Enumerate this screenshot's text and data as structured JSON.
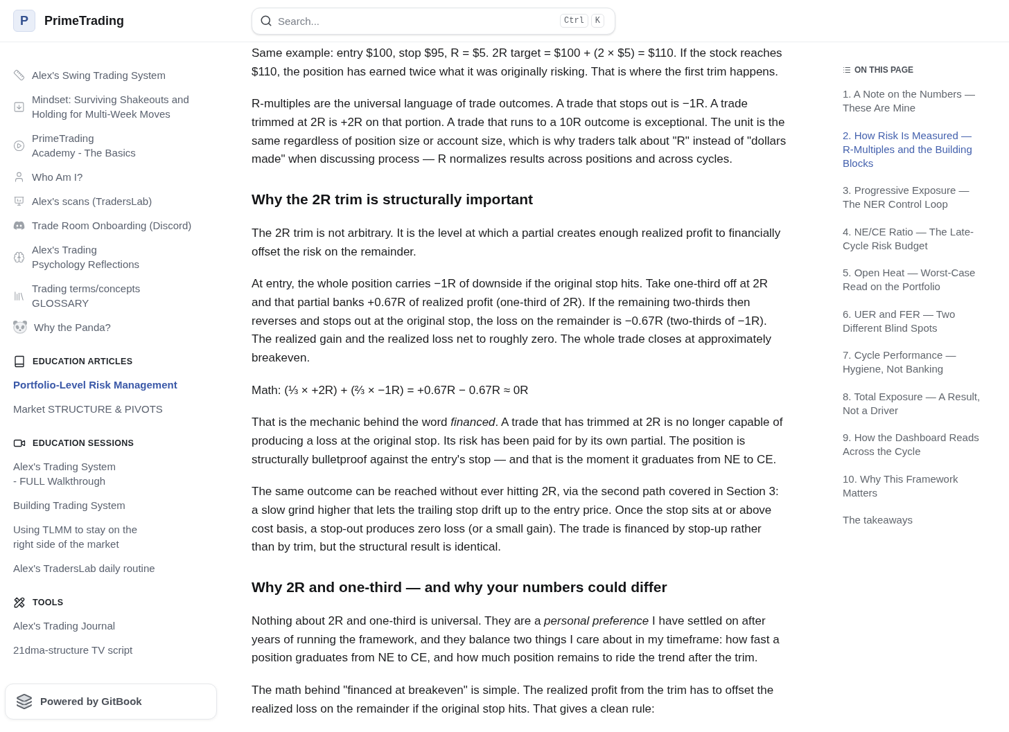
{
  "header": {
    "logo_letter": "P",
    "site_name": "PrimeTrading",
    "search": {
      "placeholder": "Search...",
      "shortcut": [
        "Ctrl",
        "K"
      ]
    }
  },
  "sidebar": {
    "items": [
      {
        "label": "Alex's Swing Trading System",
        "selected": false
      },
      {
        "label": "Mindset: Surviving Shakeouts and\nHolding for Multi-Week Moves",
        "selected": false
      },
      {
        "label": "PrimeTrading\nAcademy - The Basics",
        "selected": false
      },
      {
        "label": "Who Am I?",
        "selected": false
      },
      {
        "label": "Alex's scans (TradersLab)",
        "selected": false
      },
      {
        "label": "Trade Room Onboarding (Discord)",
        "selected": false
      },
      {
        "label": "Alex's Trading\nPsychology Reflections",
        "selected": false
      },
      {
        "label": "Trading terms/concepts\nGLOSSARY",
        "selected": false
      },
      {
        "label": "Why the Panda?",
        "selected": false
      }
    ],
    "sections": [
      {
        "title": "EDUCATION ARTICLES",
        "items": [
          {
            "label": "Portfolio-Level Risk Management",
            "selected": true
          },
          {
            "label": "Market STRUCTURE & PIVOTS",
            "selected": false
          }
        ]
      },
      {
        "title": "EDUCATION SESSIONS",
        "items": [
          {
            "label": "Alex's Trading System\n- FULL Walkthrough",
            "selected": false
          },
          {
            "label": "Building Trading System",
            "selected": false
          },
          {
            "label": "Using TLMM to stay on the\nright side of the market",
            "selected": false
          },
          {
            "label": "Alex's TradersLab daily routine",
            "selected": false
          }
        ]
      },
      {
        "title": "TOOLS",
        "items": [
          {
            "label": "Alex's Trading Journal",
            "selected": false
          },
          {
            "label": "21dma-structure TV script",
            "selected": false
          }
        ]
      }
    ],
    "footer": "Powered by GitBook"
  },
  "article": [
    {
      "kind": "paragraph",
      "text": "Same example: entry $100, stop $95, R = $5. 2R target = $100 + (2 × $5) = $110. If the stock reaches $110, the position has earned twice what it was originally risking. That is where the first trim happens."
    },
    {
      "kind": "paragraph",
      "text": "R-multiples are the universal language of trade outcomes. A trade that stops out is −1R. A trade trimmed at 2R is +2R on that portion. A trade that runs to a 10R outcome is exceptional. The unit is the same regardless of position size or account size, which is why traders talk about \"R\" instead of \"dollars made\" when discussing process — R normalizes results across positions and across cycles."
    },
    {
      "kind": "heading",
      "text": "Why the 2R trim is structurally important"
    },
    {
      "kind": "paragraph",
      "text": "The 2R trim is not arbitrary. It is the level at which a partial creates enough realized profit to financially offset the risk on the remainder."
    },
    {
      "kind": "paragraph",
      "text": "At entry, the whole position carries −1R of downside if the original stop hits. Take one-third off at 2R and that partial banks +0.67R of realized profit (one-third of 2R). If the remaining two-thirds then reverses and stops out at the original stop, the loss on the remainder is −0.67R (two-thirds of −1R). The realized gain and the realized loss net to roughly zero. The whole trade closes at approximately breakeven."
    },
    {
      "kind": "paragraph",
      "text": "Math: (⅓ × +2R) + (⅔ × −1R) = +0.67R − 0.67R ≈ 0R"
    },
    {
      "kind": "paragraph",
      "text": "That is the mechanic behind the word *financed*. A trade that has trimmed at 2R is no longer capable of producing a loss at the original stop. Its risk has been paid for by its own partial. The position is structurally bulletproof against the entry's stop — and that is the moment it graduates from NE to CE."
    },
    {
      "kind": "paragraph",
      "text": "The same outcome can be reached without ever hitting 2R, via the second path covered in Section 3: a slow grind higher that lets the trailing stop drift up to the entry price. Once the stop sits at or above cost basis, a stop-out produces zero loss (or a small gain). The trade is financed by stop-up rather than by trim, but the structural result is identical."
    },
    {
      "kind": "heading",
      "text": "Why 2R and one-third — and why your numbers could differ"
    },
    {
      "kind": "paragraph",
      "text": "Nothing about 2R and one-third is universal. They are a *personal preference* I have settled on after years of running the framework, and they balance two things I care about in my timeframe: how fast a position graduates from NE to CE, and how much position remains to ride the trend after the trim."
    },
    {
      "kind": "paragraph",
      "text": "The math behind \"financed at breakeven\" is simple. The realized profit from the trim has to offset the realized loss on the remainder if the original stop hits. That gives a clean rule:"
    }
  ],
  "toc": {
    "title": "ON THIS PAGE",
    "items": [
      {
        "label": "1. A Note on the Numbers —\nThese Are Mine",
        "selected": false
      },
      {
        "label": "2. How Risk Is Measured —\nR-Multiples and the Building\nBlocks",
        "selected": true
      },
      {
        "label": "3. Progressive Exposure —\nThe NER Control Loop",
        "selected": false
      },
      {
        "label": "4. NE/CE Ratio — The Late-\nCycle Risk Budget",
        "selected": false
      },
      {
        "label": "5. Open Heat — Worst-Case\nRead on the Portfolio",
        "selected": false
      },
      {
        "label": "6. UER and FER — Two\nDifferent Blind Spots",
        "selected": false
      },
      {
        "label": "7. Cycle Performance —\nHygiene, Not Banking",
        "selected": false
      },
      {
        "label": "8. Total Exposure — A Result,\nNot a Driver",
        "selected": false
      },
      {
        "label": "9. How the Dashboard Reads\nAcross the Cycle",
        "selected": false
      },
      {
        "label": "10. Why This Framework\nMatters",
        "selected": false
      },
      {
        "label": "The takeaways",
        "selected": false
      }
    ]
  }
}
